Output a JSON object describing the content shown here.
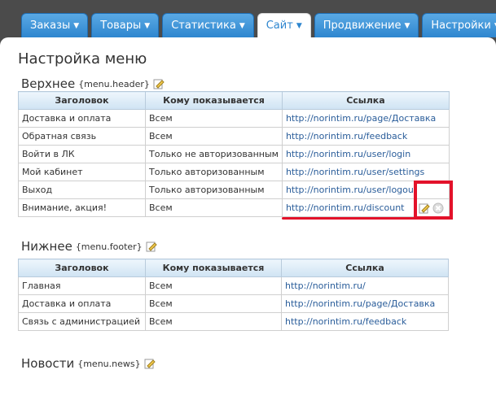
{
  "tabs": [
    {
      "label": "Заказы",
      "active": false
    },
    {
      "label": "Товары",
      "active": false
    },
    {
      "label": "Статистика",
      "active": false
    },
    {
      "label": "Сайт",
      "active": true
    },
    {
      "label": "Продвижение",
      "active": false
    },
    {
      "label": "Настройки",
      "active": false
    }
  ],
  "page": {
    "title": "Настройка меню"
  },
  "sections": {
    "header": {
      "title": "Верхнее",
      "code": "{menu.header}",
      "columns": [
        "Заголовок",
        "Кому показывается",
        "Ссылка"
      ],
      "rows": [
        [
          "Доставка и оплата",
          "Всем",
          "http://norintim.ru/page/Доставка"
        ],
        [
          "Обратная связь",
          "Всем",
          "http://norintim.ru/feedback"
        ],
        [
          "Войти в ЛК",
          "Только не авторизованным",
          "http://norintim.ru/user/login"
        ],
        [
          "Мой кабинет",
          "Только авторизованным",
          "http://norintim.ru/user/settings"
        ],
        [
          "Выход",
          "Только авторизованным",
          "http://norintim.ru/user/logout"
        ],
        [
          "Внимание, акция!",
          "Всем",
          "http://norintim.ru/discount"
        ]
      ]
    },
    "footer": {
      "title": "Нижнее",
      "code": "{menu.footer}",
      "columns": [
        "Заголовок",
        "Кому показывается",
        "Ссылка"
      ],
      "rows": [
        [
          "Главная",
          "Всем",
          "http://norintim.ru/"
        ],
        [
          "Доставка и оплата",
          "Всем",
          "http://norintim.ru/page/Доставка"
        ],
        [
          "Связь с администрацией",
          "Всем",
          "http://norintim.ru/feedback"
        ]
      ]
    },
    "news": {
      "title": "Новости",
      "code": "{menu.news}"
    }
  },
  "colors": {
    "tab": "#2e86cf",
    "link": "#2a5d9a",
    "highlight": "#e3122a"
  }
}
